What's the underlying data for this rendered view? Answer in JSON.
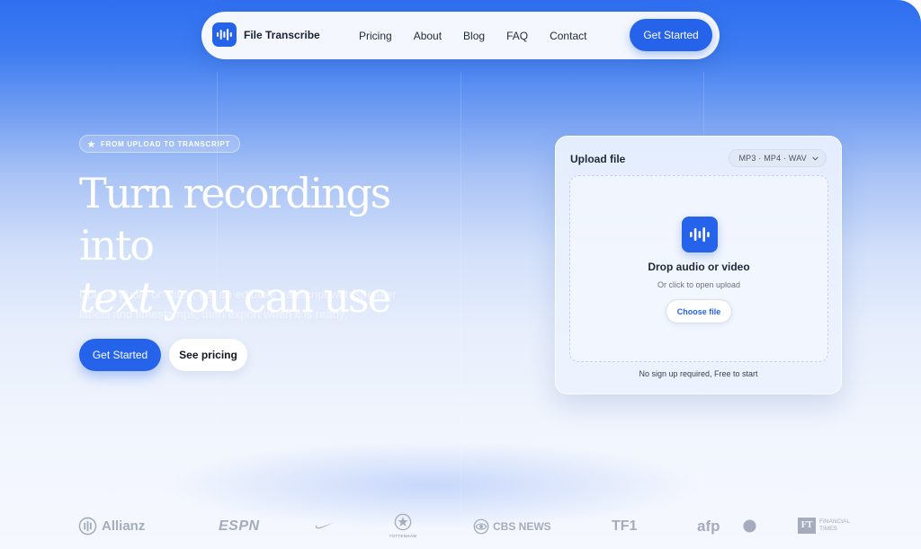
{
  "nav": {
    "brand": "File Transcribe",
    "links": [
      "Pricing",
      "About",
      "Blog",
      "FAQ",
      "Contact"
    ],
    "cta": "Get Started"
  },
  "hero": {
    "badge": "FROM UPLOAD TO TRANSCRIPT",
    "title_line1": "Turn recordings into",
    "title_em": "text",
    "title_rest": " you can use",
    "subtitle": "Upload audio or video, get an editable transcript with speaker labels and timestamps, then export when it is ready.",
    "primary_button": "Get Started",
    "secondary_button": "See pricing"
  },
  "upload": {
    "title": "Upload file",
    "formats": "MP3 · MP4 · WAV",
    "drop_title": "Drop audio or video",
    "drop_subtitle": "Or click to open upload",
    "choose_button": "Choose file",
    "footer": "No sign up required, Free to start"
  },
  "logos": {
    "allianz": "Allianz",
    "espn": "ESPN",
    "tottenham": "TOTTENHAM",
    "cbs": "CBS NEWS",
    "tf1": "TF1",
    "afp": "afp",
    "ft_mark": "FT",
    "ft_line1": "FINANCIAL",
    "ft_line2": "TIMES"
  },
  "colors": {
    "accent": "#2563eb",
    "hero_top": "#2f6ff0",
    "text_dark": "#1f2937",
    "logo_gray": "#a4acbd"
  },
  "icons": {
    "brand": "audio-waveform-icon",
    "badge": "star-icon",
    "select": "chevron-down-icon",
    "dropzone": "audio-waveform-icon"
  }
}
